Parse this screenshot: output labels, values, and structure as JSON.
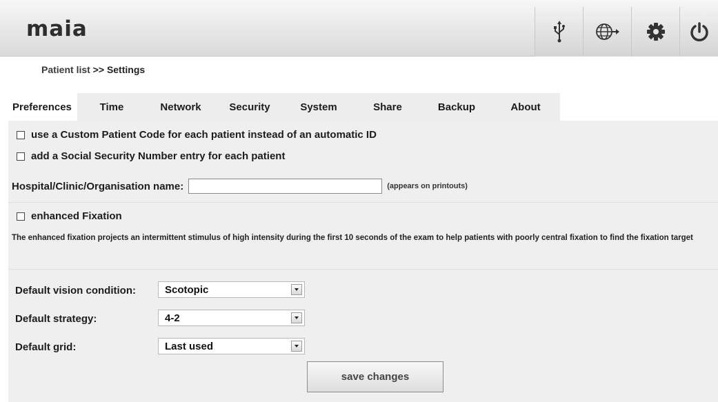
{
  "header": {
    "logo": "maia",
    "buttons": [
      {
        "name": "usb-icon"
      },
      {
        "name": "network-globe-icon"
      },
      {
        "name": "gear-icon"
      },
      {
        "name": "power-icon"
      }
    ]
  },
  "breadcrumb": {
    "link": "Patient list",
    "separator": " >> ",
    "current": "Settings"
  },
  "tabs": [
    {
      "label": "Preferences",
      "active": true
    },
    {
      "label": "Time"
    },
    {
      "label": "Network"
    },
    {
      "label": "Security"
    },
    {
      "label": "System"
    },
    {
      "label": "Share"
    },
    {
      "label": "Backup"
    },
    {
      "label": "About"
    }
  ],
  "preferences": {
    "custom_code_label": "use a Custom Patient Code for each patient instead of an automatic ID",
    "custom_code_checked": false,
    "ssn_label": "add a Social Security Number entry for each patient",
    "ssn_checked": false,
    "org_label": "Hospital/Clinic/Organisation name:",
    "org_value": "",
    "org_hint": "(appears on printouts)",
    "fixation_label": "enhanced Fixation",
    "fixation_checked": false,
    "fixation_desc": "The enhanced fixation projects an intermittent stimulus of high intensity during the first 10 seconds of the exam to help patients with poorly central fixation to find the fixation target",
    "vision_label": "Default vision condition:",
    "vision_value": "Scotopic",
    "strategy_label": "Default strategy:",
    "strategy_value": "4-2",
    "grid_label": "Default grid:",
    "grid_value": "Last used",
    "save_label": "save changes"
  }
}
